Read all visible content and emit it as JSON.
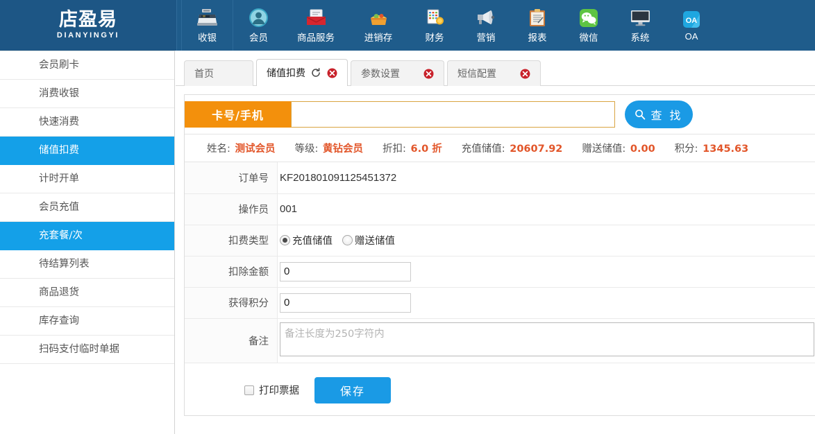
{
  "brand": {
    "name_cn": "店盈易",
    "name_en": "DIANYINGYI"
  },
  "topnav": {
    "items": [
      {
        "label": "收银",
        "icon": "cash-register-icon"
      },
      {
        "label": "会员",
        "icon": "member-avatar-icon"
      },
      {
        "label": "商品服务",
        "icon": "product-box-icon"
      },
      {
        "label": "进销存",
        "icon": "inventory-icon"
      },
      {
        "label": "财务",
        "icon": "finance-abacus-icon"
      },
      {
        "label": "营销",
        "icon": "megaphone-icon"
      },
      {
        "label": "报表",
        "icon": "clipboard-report-icon"
      },
      {
        "label": "微信",
        "icon": "wechat-icon"
      },
      {
        "label": "系统",
        "icon": "monitor-system-icon"
      },
      {
        "label": "OA",
        "icon": "oa-icon"
      }
    ]
  },
  "sidebar": {
    "items": [
      {
        "label": "会员刷卡",
        "active": false
      },
      {
        "label": "消费收银",
        "active": false
      },
      {
        "label": "快速消费",
        "active": false
      },
      {
        "label": "储值扣费",
        "active": true
      },
      {
        "label": "计时开单",
        "active": false
      },
      {
        "label": "会员充值",
        "active": false
      },
      {
        "label": "充套餐/次",
        "active": true
      },
      {
        "label": "待结算列表",
        "active": false
      },
      {
        "label": "商品退货",
        "active": false
      },
      {
        "label": "库存查询",
        "active": false
      },
      {
        "label": "扫码支付临时单据",
        "active": false
      }
    ]
  },
  "tabs": [
    {
      "label": "首页",
      "active": false,
      "closable": false,
      "refreshable": false
    },
    {
      "label": "储值扣费",
      "active": true,
      "closable": true,
      "refreshable": true
    },
    {
      "label": "参数设置",
      "active": false,
      "closable": true,
      "refreshable": false
    },
    {
      "label": "短信配置",
      "active": false,
      "closable": true,
      "refreshable": false
    }
  ],
  "search": {
    "tag_label": "卡号/手机",
    "input_value": "",
    "input_placeholder": "",
    "button_label": "查 找",
    "button_icon": "search-icon"
  },
  "member_info": [
    {
      "label": "姓名:",
      "value": "测试会员"
    },
    {
      "label": "等级:",
      "value": "黄钻会员"
    },
    {
      "label": "折扣:",
      "value": "6.0 折"
    },
    {
      "label": "充值储值:",
      "value": "20607.92"
    },
    {
      "label": "赠送储值:",
      "value": "0.00"
    },
    {
      "label": "积分:",
      "value": "1345.63"
    }
  ],
  "form": {
    "order_no": {
      "label": "订单号",
      "value": "KF201801091125451372"
    },
    "operator": {
      "label": "操作员",
      "value": "001"
    },
    "deduct_type": {
      "label": "扣费类型",
      "options": [
        {
          "label": "充值储值",
          "selected": true
        },
        {
          "label": "赠送储值",
          "selected": false
        }
      ]
    },
    "deduct_amount": {
      "label": "扣除金额",
      "value": "0"
    },
    "earned_points": {
      "label": "获得积分",
      "value": "0"
    },
    "remark": {
      "label": "备注",
      "value": "",
      "placeholder": "备注长度为250字符内"
    }
  },
  "footer": {
    "print_checkbox_label": "打印票据",
    "print_checked": false,
    "save_label": "保存"
  },
  "colors": {
    "topbar_blue": "#1f5c8b",
    "accent_blue": "#14a0e8",
    "button_blue": "#1a9ae5",
    "orange_tag": "#f3900c",
    "value_orange": "#e2562a",
    "close_red": "#c8212a"
  }
}
